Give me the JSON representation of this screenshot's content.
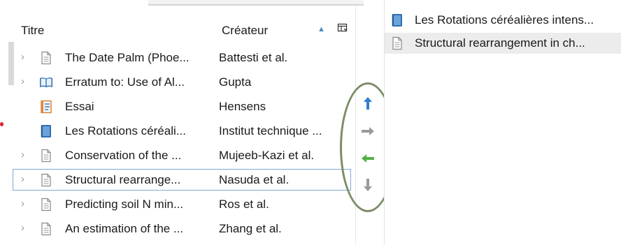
{
  "left_pane": {
    "columns": {
      "title": "Titre",
      "creator": "Créateur"
    },
    "rows": [
      {
        "title": "The Date Palm (Phoe...",
        "creator": "Battesti et al.",
        "icon": "document-icon",
        "has_children": true,
        "selected": false
      },
      {
        "title": "Erratum to: Use of Al...",
        "creator": "Gupta",
        "icon": "book-open-icon",
        "has_children": true,
        "selected": false
      },
      {
        "title": "Essai",
        "creator": "Hensens",
        "icon": "essay-icon",
        "has_children": false,
        "selected": false
      },
      {
        "title": "Les Rotations céréali...",
        "creator": "Institut technique ...",
        "icon": "book-icon",
        "has_children": false,
        "selected": false
      },
      {
        "title": "Conservation of the ...",
        "creator": "Mujeeb-Kazi et al.",
        "icon": "document-icon",
        "has_children": true,
        "selected": false
      },
      {
        "title": "Structural rearrange...",
        "creator": "Nasuda et al.",
        "icon": "document-icon",
        "has_children": true,
        "selected": true
      },
      {
        "title": "Predicting soil N min...",
        "creator": "Ros et al.",
        "icon": "document-icon",
        "has_children": true,
        "selected": false
      },
      {
        "title": "An estimation of the ...",
        "creator": "Zhang et al.",
        "icon": "document-icon",
        "has_children": true,
        "selected": false
      }
    ]
  },
  "arrows": {
    "up": "up-arrow-icon",
    "right": "right-arrow-icon",
    "left": "left-arrow-icon",
    "down": "down-arrow-icon"
  },
  "right_pane": {
    "items": [
      {
        "text": "Les Rotations céréalières intens...",
        "icon": "book-icon",
        "selected": false
      },
      {
        "text": "Structural rearrangement in ch...",
        "icon": "document-icon",
        "selected": true
      }
    ]
  },
  "colors": {
    "oval": "#7c8c66",
    "up_arrow": "#2f7fd6",
    "right_arrow": "#9a9a9a",
    "left_arrow": "#52b145",
    "down_arrow": "#9a9a9a"
  }
}
